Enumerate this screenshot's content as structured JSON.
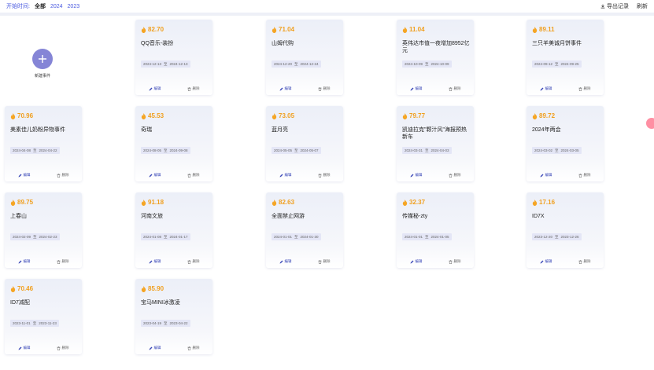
{
  "filter": {
    "label": "开始时间:",
    "options": [
      "全部",
      "2024",
      "2023"
    ],
    "active": 0
  },
  "toolbar": {
    "export": "导出记录",
    "refresh": "刷新"
  },
  "new_event": {
    "label": "新建事件"
  },
  "card_actions": {
    "edit": "编辑",
    "delete": "删除",
    "date_sep": "至"
  },
  "cards": [
    {
      "score": "82.70",
      "title": "QQ音乐-装扮",
      "start": "2024-12-13",
      "end": "2024-12-13"
    },
    {
      "score": "71.04",
      "title": "山姆代购",
      "start": "2024-12-20",
      "end": "2024-12-24"
    },
    {
      "score": "11.04",
      "title": "英伟达市值一夜增加8952亿元",
      "start": "2024-10-09",
      "end": "2024-10-09"
    },
    {
      "score": "89.11",
      "title": "三只羊美诚月饼事件",
      "start": "2024-09-12",
      "end": "2024-09-25"
    },
    {
      "score": "70.96",
      "title": "美素佳儿奶粉异物事件",
      "start": "2024-04-08",
      "end": "2024-04-22"
    },
    {
      "score": "45.53",
      "title": "奇瑞",
      "start": "2024-08-05",
      "end": "2024-09-08"
    },
    {
      "score": "73.05",
      "title": "蓝月亮",
      "start": "2024-05-05",
      "end": "2024-05-07"
    },
    {
      "score": "79.77",
      "title": "凯迪拉克\"颗汁风\"海报预热新车",
      "start": "2024-03-31",
      "end": "2024-04-03"
    },
    {
      "score": "89.72",
      "title": "2024年两会",
      "start": "2024-03-02",
      "end": "2024-03-05"
    },
    {
      "score": "89.75",
      "title": "上春山",
      "start": "2024-02-09",
      "end": "2024-02-23"
    },
    {
      "score": "91.18",
      "title": "河南文旅",
      "start": "2024-01-08",
      "end": "2024-01-17"
    },
    {
      "score": "82.63",
      "title": "全面禁止网游",
      "start": "2024-01-01",
      "end": "2024-01-30"
    },
    {
      "score": "32.37",
      "title": "传媒秘-zty",
      "start": "2024-01-01",
      "end": "2024-01-05"
    },
    {
      "score": "17.16",
      "title": "ID7X",
      "start": "2023-12-20",
      "end": "2023-12-26"
    },
    {
      "score": "70.46",
      "title": "ID7减配",
      "start": "2023-11-01",
      "end": "2023-11-23"
    },
    {
      "score": "85.90",
      "title": "宝马MINI冰激凌",
      "start": "2023-04-19",
      "start2": "",
      "end": "2023-04-22"
    }
  ]
}
